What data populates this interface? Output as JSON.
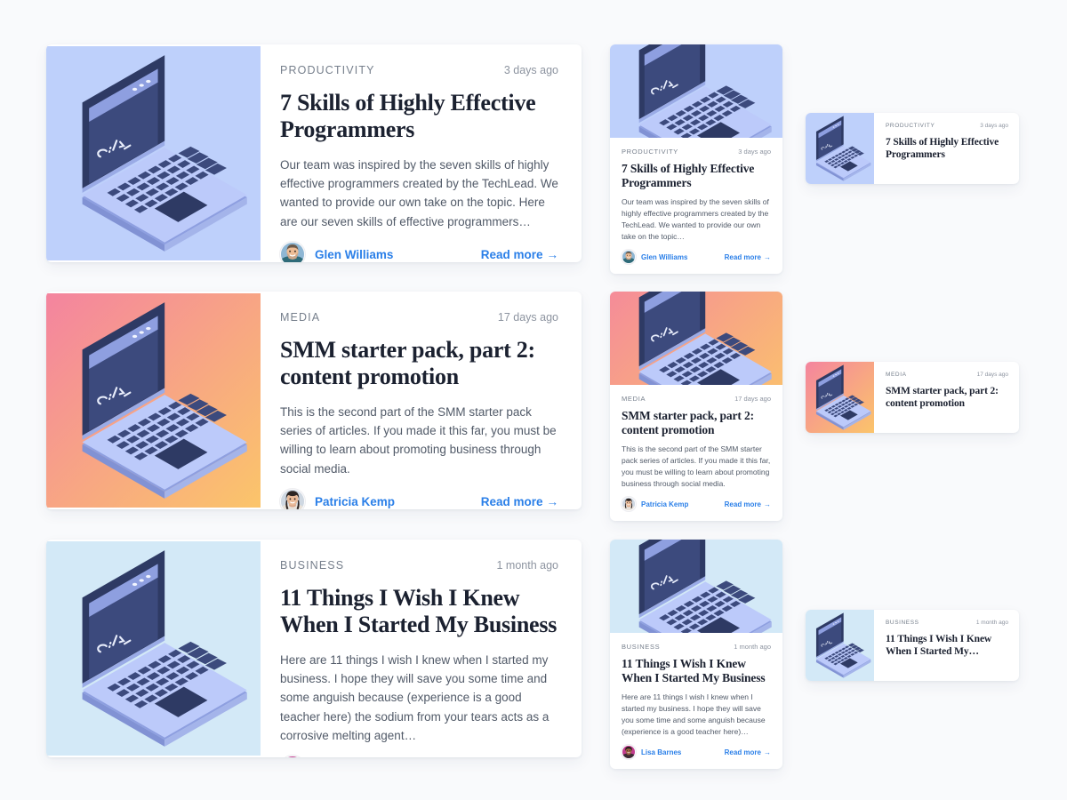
{
  "page": {
    "background_color": "#f9fafc",
    "accent_color": "#2a7fe8",
    "title_color": "#1b2130"
  },
  "labels": {
    "read_more": "Read more",
    "arrow_glyph": "→"
  },
  "articles": [
    {
      "id": "skills-programmers",
      "category": "PRODUCTIVITY",
      "date": "3 days ago",
      "title": "7 Skills of Highly Effective Programmers",
      "title_medium": "7 Skills of Highly Effective Programmers",
      "title_small": "7 Skills of Highly Effective Programmers",
      "excerpt": "Our team was inspired by the seven skills of highly effective programmers created by the TechLead. We wanted to provide our own take on the topic. Here are our seven skills of effective programmers…",
      "excerpt_medium": "Our team was inspired by the seven skills of highly effective programmers created by the TechLead. We wanted to provide our own take on the topic…",
      "author": "Glen Williams",
      "thumbnail_style": "solid-periwinkle",
      "thumbnail_colors": [
        "#bed0fb",
        "#bed0fb"
      ]
    },
    {
      "id": "smm-starter-pack",
      "category": "MEDIA",
      "date": "17 days ago",
      "title": "SMM starter pack, part 2: content promotion",
      "title_medium": "SMM starter pack, part 2: content promotion",
      "title_small": "SMM starter pack, part 2: content promotion",
      "excerpt": "This is the second part of the SMM starter pack series of articles. If you made it this far, you must be willing to learn about promoting business through social media.",
      "excerpt_medium": "This is the second part of the SMM starter pack series of articles. If you made it this far, you must be willing to learn about promoting business through social media.",
      "author": "Patricia Kemp",
      "thumbnail_style": "gradient-pink-orange",
      "thumbnail_colors": [
        "#f4849f",
        "#fbc56a"
      ]
    },
    {
      "id": "things-i-wish-i-knew",
      "category": "BUSINESS",
      "date": "1 month ago",
      "title": "11 Things I Wish I Knew When I Started My Business",
      "title_medium": "11 Things I Wish I Knew When I Started My Business",
      "title_small": "11 Things I Wish I Knew When I Started My…",
      "excerpt": "Here are 11 things I wish I knew when I started my business. I hope they will save you some time and some anguish because (experience is a good teacher here) the sodium from your tears acts as a corrosive melting agent…",
      "excerpt_medium": "Here are 11 things I wish I knew when I started my business. I hope they will save you some time and some anguish because (experience is a good teacher here)…",
      "author": "Lisa Barnes",
      "thumbnail_style": "solid-lightblue",
      "thumbnail_colors": [
        "#d3e9f7",
        "#d3e9f7"
      ]
    }
  ],
  "illustration": {
    "name": "isometric-laptop-terminal",
    "screen_text": "c:\\>",
    "screen_color": "#3c4a7d",
    "body_color": "#b6c4f5",
    "bezel_color": "#2e3a64"
  }
}
